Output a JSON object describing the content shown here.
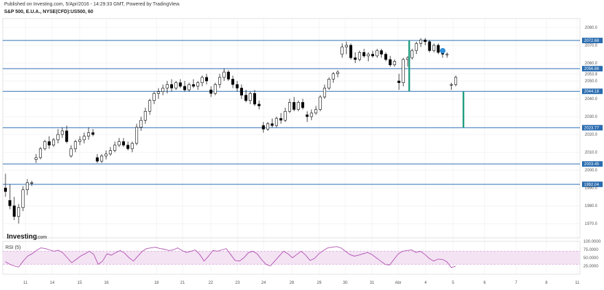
{
  "header": {
    "published": "Published on Investing.com, 5/Apr/2016 - 14:29:33 GMT, Powered by TradingView.",
    "symbol": "S&P 500, E.U.A., NYSE(CFD):US500, 60"
  },
  "watermark": {
    "brand": "Investing",
    "suffix": ".com"
  },
  "rsi_label": "RSI (5)",
  "colors": {
    "level_line": "#2b6cb0",
    "level_label_bg": "#2b6cb0",
    "bull": "#ffffff",
    "bear": "#000000",
    "wick": "#000000",
    "range_marker": "#1e9c7e",
    "rsi_line": "#b04cb0",
    "rsi_band": "#f3e3f3",
    "grid": "#e8e8e8",
    "dot": "#2e8fd6"
  },
  "chart_data": [
    {
      "type": "candlestick",
      "title": "S&P 500, E.U.A., NYSE(CFD):US500, 60",
      "xlabel": "",
      "ylabel": "",
      "x_ticks": [
        "11",
        "14",
        "15",
        "16",
        "18",
        "21",
        "22",
        "23",
        "24",
        "28",
        "29",
        "30",
        "31",
        "Abr",
        "4",
        "5",
        "6",
        "7",
        "8",
        "11"
      ],
      "y_ticks": [
        1970.0,
        1980.0,
        1990.0,
        2000.0,
        2010.0,
        2020.0,
        2030.0,
        2040.0,
        2050.0,
        2053.9,
        2060.0,
        2070.0,
        2080.0
      ],
      "ylim": [
        1962,
        2085
      ],
      "horizontal_levels": [
        "2072.68",
        "2056.88",
        "2044.18",
        "2023.77",
        "2003.45",
        "1992.04"
      ],
      "candles": [
        {
          "o": 1990,
          "h": 1998,
          "l": 1985,
          "c": 1988
        },
        {
          "o": 1983,
          "h": 1992,
          "l": 1978,
          "c": 1980
        },
        {
          "o": 1980,
          "h": 1985,
          "l": 1972,
          "c": 1974
        },
        {
          "o": 1974,
          "h": 1981,
          "l": 1970,
          "c": 1979
        },
        {
          "o": 1979,
          "h": 1991,
          "l": 1977,
          "c": 1989
        },
        {
          "o": 1989,
          "h": 1995,
          "l": 1986,
          "c": 1993
        },
        {
          "o": 1993,
          "h": 1994,
          "l": 1991,
          "c": 1993
        },
        {
          "o": 2006,
          "h": 2009,
          "l": 2004,
          "c": 2007
        },
        {
          "o": 2007,
          "h": 2013,
          "l": 2006,
          "c": 2012
        },
        {
          "o": 2012,
          "h": 2017,
          "l": 2011,
          "c": 2016
        },
        {
          "o": 2016,
          "h": 2019,
          "l": 2012,
          "c": 2014
        },
        {
          "o": 2014,
          "h": 2018,
          "l": 2013,
          "c": 2017
        },
        {
          "o": 2017,
          "h": 2023,
          "l": 2015,
          "c": 2020
        },
        {
          "o": 2020,
          "h": 2024,
          "l": 2018,
          "c": 2022
        },
        {
          "o": 2022,
          "h": 2025,
          "l": 2015,
          "c": 2016
        },
        {
          "o": 2008,
          "h": 2014,
          "l": 2007,
          "c": 2012
        },
        {
          "o": 2012,
          "h": 2017,
          "l": 2010,
          "c": 2016
        },
        {
          "o": 2016,
          "h": 2019,
          "l": 2014,
          "c": 2017
        },
        {
          "o": 2017,
          "h": 2021,
          "l": 2015,
          "c": 2019
        },
        {
          "o": 2019,
          "h": 2024,
          "l": 2017,
          "c": 2021
        },
        {
          "o": 2021,
          "h": 2023,
          "l": 2019,
          "c": 2020
        },
        {
          "o": 2007,
          "h": 2009,
          "l": 2004,
          "c": 2005
        },
        {
          "o": 2005,
          "h": 2009,
          "l": 2004,
          "c": 2008
        },
        {
          "o": 2008,
          "h": 2011,
          "l": 2006,
          "c": 2009
        },
        {
          "o": 2009,
          "h": 2013,
          "l": 2008,
          "c": 2011
        },
        {
          "o": 2011,
          "h": 2016,
          "l": 2010,
          "c": 2014
        },
        {
          "o": 2014,
          "h": 2018,
          "l": 2013,
          "c": 2016
        },
        {
          "o": 2016,
          "h": 2018,
          "l": 2013,
          "c": 2014
        },
        {
          "o": 2014,
          "h": 2016,
          "l": 2011,
          "c": 2012
        },
        {
          "o": 2012,
          "h": 2016,
          "l": 2010,
          "c": 2015
        },
        {
          "o": 2015,
          "h": 2026,
          "l": 2014,
          "c": 2024
        },
        {
          "o": 2024,
          "h": 2030,
          "l": 2022,
          "c": 2028
        },
        {
          "o": 2028,
          "h": 2035,
          "l": 2026,
          "c": 2033
        },
        {
          "o": 2033,
          "h": 2040,
          "l": 2031,
          "c": 2039
        },
        {
          "o": 2039,
          "h": 2044,
          "l": 2037,
          "c": 2043
        },
        {
          "o": 2043,
          "h": 2046,
          "l": 2040,
          "c": 2044
        },
        {
          "o": 2044,
          "h": 2048,
          "l": 2042,
          "c": 2046
        },
        {
          "o": 2046,
          "h": 2050,
          "l": 2043,
          "c": 2048
        },
        {
          "o": 2048,
          "h": 2051,
          "l": 2044,
          "c": 2046
        },
        {
          "o": 2046,
          "h": 2050,
          "l": 2045,
          "c": 2049
        },
        {
          "o": 2049,
          "h": 2051,
          "l": 2046,
          "c": 2047
        },
        {
          "o": 2047,
          "h": 2050,
          "l": 2044,
          "c": 2045
        },
        {
          "o": 2045,
          "h": 2049,
          "l": 2044,
          "c": 2048
        },
        {
          "o": 2048,
          "h": 2051,
          "l": 2046,
          "c": 2047
        },
        {
          "o": 2047,
          "h": 2050,
          "l": 2045,
          "c": 2049
        },
        {
          "o": 2049,
          "h": 2053,
          "l": 2047,
          "c": 2052
        },
        {
          "o": 2052,
          "h": 2054,
          "l": 2048,
          "c": 2050
        },
        {
          "o": 2045,
          "h": 2047,
          "l": 2041,
          "c": 2043
        },
        {
          "o": 2043,
          "h": 2049,
          "l": 2042,
          "c": 2048
        },
        {
          "o": 2048,
          "h": 2054,
          "l": 2046,
          "c": 2052
        },
        {
          "o": 2052,
          "h": 2057,
          "l": 2050,
          "c": 2055
        },
        {
          "o": 2055,
          "h": 2056,
          "l": 2050,
          "c": 2051
        },
        {
          "o": 2051,
          "h": 2053,
          "l": 2046,
          "c": 2048
        },
        {
          "o": 2048,
          "h": 2050,
          "l": 2044,
          "c": 2046
        },
        {
          "o": 2046,
          "h": 2048,
          "l": 2040,
          "c": 2042
        },
        {
          "o": 2042,
          "h": 2045,
          "l": 2038,
          "c": 2039
        },
        {
          "o": 2039,
          "h": 2044,
          "l": 2037,
          "c": 2043
        },
        {
          "o": 2043,
          "h": 2045,
          "l": 2036,
          "c": 2037
        },
        {
          "o": 2037,
          "h": 2039,
          "l": 2034,
          "c": 2036
        },
        {
          "o": 2025,
          "h": 2027,
          "l": 2021,
          "c": 2023
        },
        {
          "o": 2023,
          "h": 2027,
          "l": 2022,
          "c": 2026
        },
        {
          "o": 2026,
          "h": 2029,
          "l": 2024,
          "c": 2025
        },
        {
          "o": 2025,
          "h": 2030,
          "l": 2024,
          "c": 2029
        },
        {
          "o": 2029,
          "h": 2032,
          "l": 2026,
          "c": 2028
        },
        {
          "o": 2028,
          "h": 2035,
          "l": 2027,
          "c": 2033
        },
        {
          "o": 2033,
          "h": 2040,
          "l": 2032,
          "c": 2038
        },
        {
          "o": 2038,
          "h": 2041,
          "l": 2033,
          "c": 2034
        },
        {
          "o": 2034,
          "h": 2039,
          "l": 2033,
          "c": 2038
        },
        {
          "o": 2038,
          "h": 2040,
          "l": 2034,
          "c": 2035
        },
        {
          "o": 2031,
          "h": 2033,
          "l": 2027,
          "c": 2030
        },
        {
          "o": 2030,
          "h": 2034,
          "l": 2028,
          "c": 2032
        },
        {
          "o": 2032,
          "h": 2036,
          "l": 2031,
          "c": 2034
        },
        {
          "o": 2034,
          "h": 2042,
          "l": 2033,
          "c": 2041
        },
        {
          "o": 2041,
          "h": 2048,
          "l": 2040,
          "c": 2046
        },
        {
          "o": 2046,
          "h": 2052,
          "l": 2045,
          "c": 2051
        },
        {
          "o": 2051,
          "h": 2055,
          "l": 2049,
          "c": 2054
        },
        {
          "o": 2054,
          "h": 2056,
          "l": 2052,
          "c": 2055
        },
        {
          "o": 2065,
          "h": 2071,
          "l": 2063,
          "c": 2069
        },
        {
          "o": 2069,
          "h": 2072,
          "l": 2065,
          "c": 2070
        },
        {
          "o": 2070,
          "h": 2071,
          "l": 2062,
          "c": 2063
        },
        {
          "o": 2063,
          "h": 2066,
          "l": 2060,
          "c": 2062
        },
        {
          "o": 2062,
          "h": 2067,
          "l": 2061,
          "c": 2066
        },
        {
          "o": 2066,
          "h": 2068,
          "l": 2063,
          "c": 2064
        },
        {
          "o": 2064,
          "h": 2066,
          "l": 2061,
          "c": 2065
        },
        {
          "o": 2065,
          "h": 2067,
          "l": 2063,
          "c": 2064
        },
        {
          "o": 2064,
          "h": 2068,
          "l": 2063,
          "c": 2067
        },
        {
          "o": 2067,
          "h": 2068,
          "l": 2063,
          "c": 2065
        },
        {
          "o": 2065,
          "h": 2066,
          "l": 2061,
          "c": 2062
        },
        {
          "o": 2062,
          "h": 2064,
          "l": 2058,
          "c": 2059
        },
        {
          "o": 2059,
          "h": 2062,
          "l": 2058,
          "c": 2061
        },
        {
          "o": 2050,
          "h": 2054,
          "l": 2045,
          "c": 2049
        },
        {
          "o": 2049,
          "h": 2063,
          "l": 2047,
          "c": 2062
        },
        {
          "o": 2062,
          "h": 2064,
          "l": 2058,
          "c": 2063
        },
        {
          "o": 2063,
          "h": 2068,
          "l": 2062,
          "c": 2067
        },
        {
          "o": 2067,
          "h": 2072,
          "l": 2065,
          "c": 2071
        },
        {
          "o": 2071,
          "h": 2074,
          "l": 2069,
          "c": 2073
        },
        {
          "o": 2073,
          "h": 2074,
          "l": 2070,
          "c": 2072
        },
        {
          "o": 2072,
          "h": 2073,
          "l": 2066,
          "c": 2067
        },
        {
          "o": 2067,
          "h": 2071,
          "l": 2066,
          "c": 2070
        },
        {
          "o": 2070,
          "h": 2071,
          "l": 2065,
          "c": 2066
        },
        {
          "o": 2066,
          "h": 2068,
          "l": 2063,
          "c": 2065
        },
        {
          "o": 2065,
          "h": 2066,
          "l": 2063,
          "c": 2065
        },
        {
          "o": 2048,
          "h": 2049,
          "l": 2045,
          "c": 2048
        },
        {
          "o": 2048,
          "h": 2053,
          "l": 2047,
          "c": 2052
        }
      ],
      "range_markers": [
        {
          "from": 2044.18,
          "to": 2072.68
        },
        {
          "from": 2023.77,
          "to": 2044.18
        }
      ]
    },
    {
      "type": "line",
      "title": "RSI (5)",
      "xlabel": "",
      "ylabel": "",
      "y_ticks": [
        "100.0000",
        "75.0000",
        "50.0000",
        "25.0000"
      ],
      "ylim": [
        0,
        100
      ],
      "band": [
        30,
        70
      ],
      "series": [
        {
          "values": [
            38,
            30,
            25,
            22,
            40,
            55,
            62,
            72,
            80,
            78,
            74,
            70,
            73,
            65,
            50,
            35,
            45,
            55,
            62,
            70,
            60,
            30,
            40,
            62,
            58,
            66,
            72,
            64,
            50,
            40,
            55,
            70,
            78,
            80,
            82,
            78,
            76,
            72,
            74,
            80,
            72,
            66,
            70,
            74,
            60,
            40,
            55,
            72,
            70,
            74,
            78,
            60,
            42,
            40,
            50,
            65,
            70,
            62,
            45,
            30,
            25,
            40,
            55,
            70,
            62,
            50,
            60,
            70,
            58,
            42,
            48,
            62,
            72,
            80,
            82,
            84,
            80,
            70,
            60,
            55,
            58,
            62,
            66,
            60,
            50,
            40,
            30,
            28,
            45,
            62,
            70,
            72,
            74,
            66,
            70,
            60,
            48,
            40,
            46,
            45,
            38,
            20,
            25
          ]
        }
      ]
    }
  ]
}
